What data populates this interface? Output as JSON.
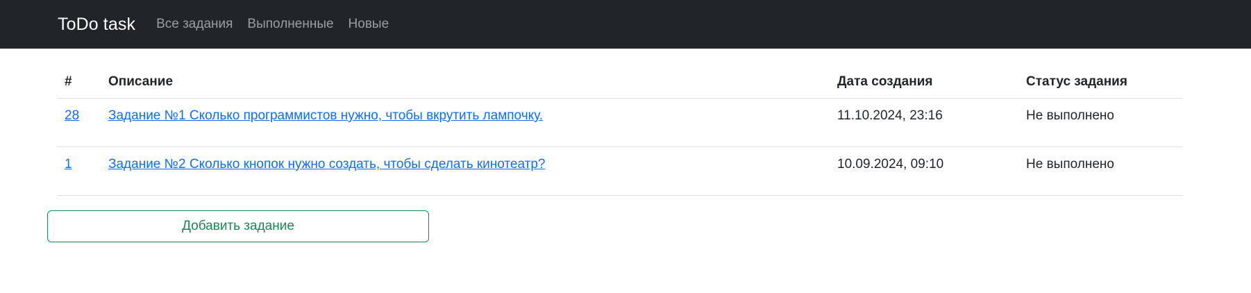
{
  "navbar": {
    "brand": "ToDo task",
    "links": [
      "Все задания",
      "Выполненные",
      "Новые"
    ]
  },
  "table": {
    "headers": [
      "#",
      "Описание",
      "Дата создания",
      "Статус задания"
    ],
    "rows": [
      {
        "id": "28",
        "description": "Задание №1 Сколько программистов нужно, чтобы вкрутить лампочку.",
        "created": "11.10.2024, 23:16",
        "status": "Не выполнено"
      },
      {
        "id": "1",
        "description": "Задание №2 Сколько кнопок нужно создать, чтобы сделать кинотеатр?",
        "created": "10.09.2024, 09:10",
        "status": "Не выполнено"
      }
    ]
  },
  "actions": {
    "add_task_label": "Добавить задание"
  },
  "colors": {
    "navbar_bg": "#212529",
    "link": "#0d6efd",
    "success": "#198754",
    "border": "#dee2e6"
  }
}
